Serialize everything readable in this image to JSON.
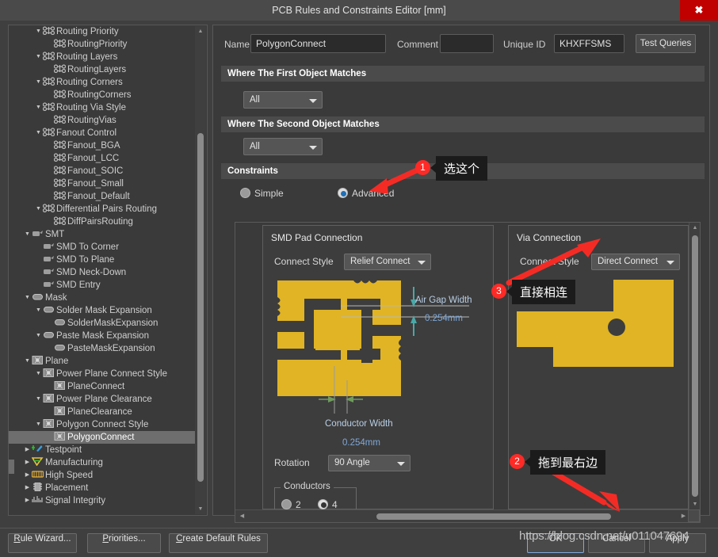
{
  "window": {
    "title": "PCB Rules and Constraints Editor [mm]",
    "close_glyph": "✖"
  },
  "tree": {
    "items": [
      {
        "label": "Routing Priority",
        "depth": 2,
        "icon": "routing-icon",
        "twisty": "down",
        "selected": false
      },
      {
        "label": "RoutingPriority",
        "depth": 3,
        "icon": "routing-icon",
        "twisty": "",
        "selected": false
      },
      {
        "label": "Routing Layers",
        "depth": 2,
        "icon": "routing-icon",
        "twisty": "down",
        "selected": false
      },
      {
        "label": "RoutingLayers",
        "depth": 3,
        "icon": "routing-icon",
        "twisty": "",
        "selected": false
      },
      {
        "label": "Routing Corners",
        "depth": 2,
        "icon": "routing-icon",
        "twisty": "down",
        "selected": false
      },
      {
        "label": "RoutingCorners",
        "depth": 3,
        "icon": "routing-icon",
        "twisty": "",
        "selected": false
      },
      {
        "label": "Routing Via Style",
        "depth": 2,
        "icon": "routing-icon",
        "twisty": "down",
        "selected": false
      },
      {
        "label": "RoutingVias",
        "depth": 3,
        "icon": "routing-icon",
        "twisty": "",
        "selected": false
      },
      {
        "label": "Fanout Control",
        "depth": 2,
        "icon": "routing-icon",
        "twisty": "down",
        "selected": false
      },
      {
        "label": "Fanout_BGA",
        "depth": 3,
        "icon": "routing-icon",
        "twisty": "",
        "selected": false
      },
      {
        "label": "Fanout_LCC",
        "depth": 3,
        "icon": "routing-icon",
        "twisty": "",
        "selected": false
      },
      {
        "label": "Fanout_SOIC",
        "depth": 3,
        "icon": "routing-icon",
        "twisty": "",
        "selected": false
      },
      {
        "label": "Fanout_Small",
        "depth": 3,
        "icon": "routing-icon",
        "twisty": "",
        "selected": false
      },
      {
        "label": "Fanout_Default",
        "depth": 3,
        "icon": "routing-icon",
        "twisty": "",
        "selected": false
      },
      {
        "label": "Differential Pairs Routing",
        "depth": 2,
        "icon": "routing-icon",
        "twisty": "down",
        "selected": false
      },
      {
        "label": "DiffPairsRouting",
        "depth": 3,
        "icon": "routing-icon",
        "twisty": "",
        "selected": false
      },
      {
        "label": "SMT",
        "depth": 1,
        "icon": "smt-icon",
        "twisty": "down",
        "selected": false
      },
      {
        "label": "SMD To Corner",
        "depth": 2,
        "icon": "smt-icon",
        "twisty": "",
        "selected": false
      },
      {
        "label": "SMD To Plane",
        "depth": 2,
        "icon": "smt-icon",
        "twisty": "",
        "selected": false
      },
      {
        "label": "SMD Neck-Down",
        "depth": 2,
        "icon": "smt-icon",
        "twisty": "",
        "selected": false
      },
      {
        "label": "SMD Entry",
        "depth": 2,
        "icon": "smt-icon",
        "twisty": "",
        "selected": false
      },
      {
        "label": "Mask",
        "depth": 1,
        "icon": "mask-icon",
        "twisty": "down",
        "selected": false
      },
      {
        "label": "Solder Mask Expansion",
        "depth": 2,
        "icon": "mask-icon",
        "twisty": "down",
        "selected": false
      },
      {
        "label": "SolderMaskExpansion",
        "depth": 3,
        "icon": "mask-icon",
        "twisty": "",
        "selected": false
      },
      {
        "label": "Paste Mask Expansion",
        "depth": 2,
        "icon": "mask-icon",
        "twisty": "down",
        "selected": false
      },
      {
        "label": "PasteMaskExpansion",
        "depth": 3,
        "icon": "mask-icon",
        "twisty": "",
        "selected": false
      },
      {
        "label": "Plane",
        "depth": 1,
        "icon": "plane-icon",
        "twisty": "down",
        "selected": false
      },
      {
        "label": "Power Plane Connect Style",
        "depth": 2,
        "icon": "plane-icon",
        "twisty": "down",
        "selected": false
      },
      {
        "label": "PlaneConnect",
        "depth": 3,
        "icon": "plane-icon",
        "twisty": "",
        "selected": false
      },
      {
        "label": "Power Plane Clearance",
        "depth": 2,
        "icon": "plane-icon",
        "twisty": "down",
        "selected": false
      },
      {
        "label": "PlaneClearance",
        "depth": 3,
        "icon": "plane-icon",
        "twisty": "",
        "selected": false
      },
      {
        "label": "Polygon Connect Style",
        "depth": 2,
        "icon": "plane-icon",
        "twisty": "down",
        "selected": false
      },
      {
        "label": "PolygonConnect",
        "depth": 3,
        "icon": "plane-icon",
        "twisty": "",
        "selected": true
      },
      {
        "label": "Testpoint",
        "depth": 1,
        "icon": "testpoint-icon",
        "twisty": "right",
        "selected": false
      },
      {
        "label": "Manufacturing",
        "depth": 1,
        "icon": "manufacturing-icon",
        "twisty": "right",
        "selected": false
      },
      {
        "label": "High Speed",
        "depth": 1,
        "icon": "highspeed-icon",
        "twisty": "right",
        "selected": false
      },
      {
        "label": "Placement",
        "depth": 1,
        "icon": "placement-icon",
        "twisty": "right",
        "selected": false
      },
      {
        "label": "Signal Integrity",
        "depth": 1,
        "icon": "signal-icon",
        "twisty": "right",
        "selected": false
      }
    ]
  },
  "form": {
    "name_label": "Name",
    "name_value": "PolygonConnect",
    "comment_label": "Comment",
    "comment_value": "",
    "comment_placeholder": "",
    "unique_id_label": "Unique ID",
    "unique_id_value": "KHXFFSMS",
    "test_queries_label": "Test Queries"
  },
  "sections": {
    "first_object": "Where The First Object Matches",
    "first_object_scope": "All",
    "second_object": "Where The Second Object Matches",
    "second_object_scope": "All",
    "constraints": "Constraints"
  },
  "constraint_mode": {
    "simple_label": "Simple",
    "advanced_label": "Advanced",
    "selected": "Advanced"
  },
  "smd_pad": {
    "group_title": "SMD Pad Connection",
    "connect_style_label": "Connect Style",
    "connect_style_value": "Relief Connect",
    "air_gap_title": "Air Gap Width",
    "air_gap_value": "0.254mm",
    "conductor_width_title": "Conductor Width",
    "conductor_width_value": "0.254mm",
    "rotation_label": "Rotation",
    "rotation_value": "90 Angle",
    "conductors_legend": "Conductors",
    "conductors_opt_2": "2",
    "conductors_opt_4": "4",
    "conductors_selected": "4"
  },
  "via": {
    "group_title": "Via Connection",
    "connect_style_label": "Connect Style",
    "connect_style_value": "Direct Connect"
  },
  "footer": {
    "rule_wizard": "Rule Wizard...",
    "priorities": "Priorities...",
    "create_default_rules": "Create Default Rules",
    "ok": "OK",
    "cancel": "Cancel",
    "apply": "Apply"
  },
  "watermark": {
    "text": "https://blog.csdn.net/u011047694"
  },
  "annotations": [
    {
      "num": "1",
      "text": "选这个"
    },
    {
      "num": "2",
      "text": "拖到最右边"
    },
    {
      "num": "3",
      "text": "直接相连"
    }
  ],
  "colors": {
    "accent_red": "#ff2a26",
    "copper": "#e0b424",
    "close_red": "#c00000",
    "dim_blue": "#7fa8d8",
    "selected_row": "#6e6e6e"
  }
}
